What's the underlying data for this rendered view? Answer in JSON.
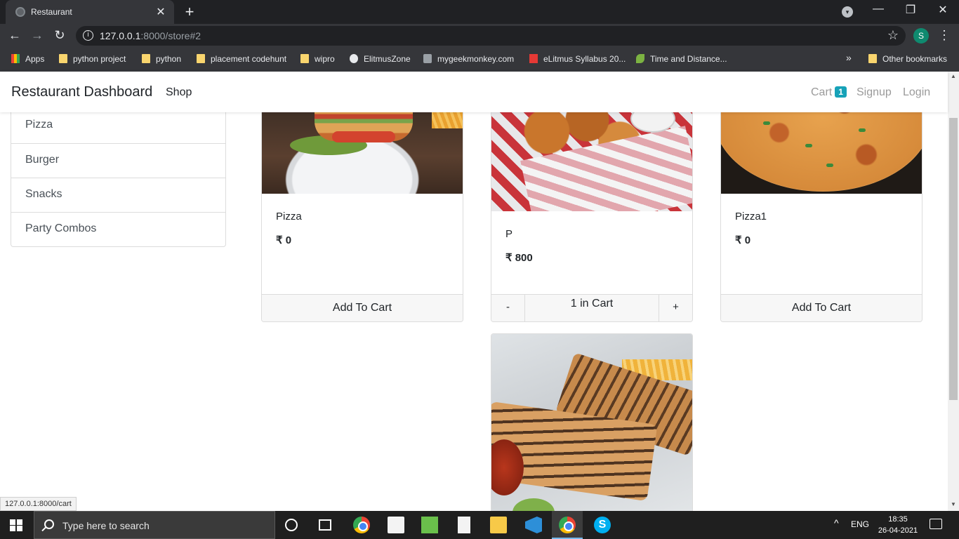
{
  "browser": {
    "tab_title": "Restaurant",
    "tab_close": "✕",
    "new_tab": "+",
    "url_host": "127.0.0.1",
    "url_rest": ":8000/store#2",
    "profile_initial": "S",
    "bookmarks": [
      {
        "label": "Apps",
        "icon": "apps-icon"
      },
      {
        "label": "python project",
        "icon": "folder-icon"
      },
      {
        "label": "python",
        "icon": "folder-icon"
      },
      {
        "label": "placement codehunt",
        "icon": "folder-icon"
      },
      {
        "label": "wipro",
        "icon": "folder-icon"
      },
      {
        "label": "ElitmusZone",
        "icon": "globe-icon"
      },
      {
        "label": "mygeekmonkey.com",
        "icon": "monkey-icon"
      },
      {
        "label": "eLitmus Syllabus 20...",
        "icon": "elitmus-icon"
      },
      {
        "label": "Time and Distance...",
        "icon": "leaf-icon"
      }
    ],
    "bookmarks_overflow": "»",
    "other_bookmarks": "Other bookmarks",
    "status_url": "127.0.0.1:8000/cart"
  },
  "navbar": {
    "brand": "Restaurant Dashboard",
    "shop": "Shop",
    "cart": "Cart",
    "cart_count": "1",
    "signup": "Signup",
    "login": "Login"
  },
  "categories": [
    "Pizza",
    "Burger",
    "Snacks",
    "Party Combos"
  ],
  "products": [
    {
      "name": "Pizza",
      "price": "₹ 0",
      "action": "Add To Cart",
      "image": "burger-photo"
    },
    {
      "name": "P",
      "price": "₹ 800",
      "qty_minus": "-",
      "qty_label": "1 in Cart",
      "qty_plus": "+",
      "image": "fried-chicken-photo"
    },
    {
      "name": "Pizza1",
      "price": "₹ 0",
      "action": "Add To Cart",
      "image": "pizza-photo"
    },
    {
      "image": "sandwich-photo"
    }
  ],
  "taskbar": {
    "search_placeholder": "Type here to search",
    "lang": "ENG",
    "time": "18:35",
    "date": "26-04-2021",
    "skype_letter": "S"
  }
}
